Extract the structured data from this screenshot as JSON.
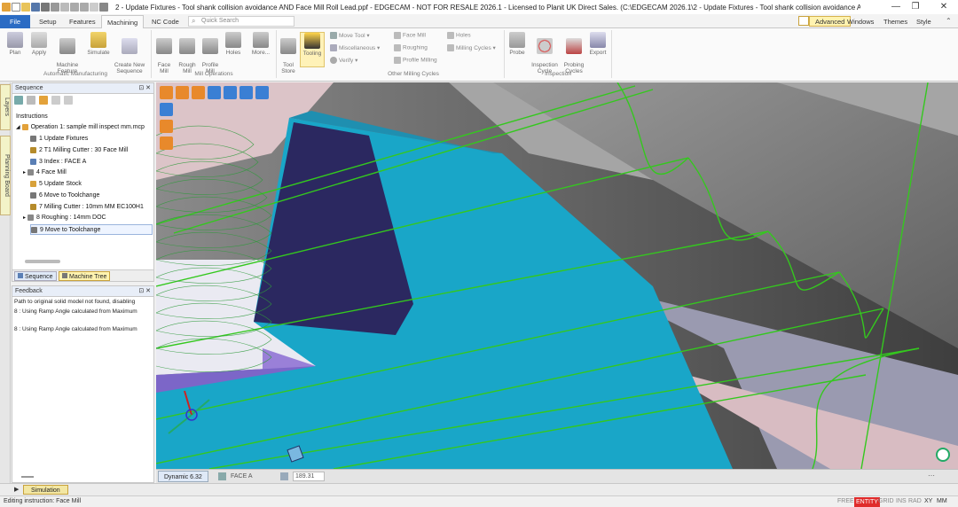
{
  "title_bar": {
    "title": "2  - Update Fixtures - Tool shank collision avoidance AND Face Mill Roll Lead.ppf - EDGECAM - NOT FOR RESALE 2026.1  - Licensed to Planit UK Direct Sales. (C:\\EDGECAM 2026.1\\2  - Update Fixtures - Tool shank collision avoidance AND ...",
    "minimize": "—",
    "maximize": "❐",
    "close": "✕"
  },
  "tabs": {
    "file": "File",
    "setup": "Setup",
    "features": "Features",
    "machining": "Machining",
    "nc_code": "NC Code",
    "search_placeholder": "Quick Search",
    "advanced": "Advanced",
    "windows": "Windows",
    "themes": "Themes",
    "style": "Style"
  },
  "ribbon": {
    "plan": "Plan",
    "apply": "Apply",
    "machine_feature": "Machine\nFeature",
    "simulate": "Simulate",
    "create_new_sequence": "Create New\nSequence",
    "face_mill": "Face\nMill",
    "rough_mill": "Rough\nMill",
    "profile_mill": "Profile\nMill",
    "holes": "Holes",
    "more": "More...",
    "tool_store": "Tool\nStore",
    "tooling": "Tooling",
    "move_tool": "Move Tool",
    "miscellaneous": "Miscellaneous",
    "verify": "Verify",
    "face_mill_small": "Face Mill",
    "roughing": "Roughing",
    "profile_milling": "Profile Milling",
    "holes_small": "Holes",
    "milling_cycles": "Milling Cycles",
    "probe": "Probe",
    "inspection_cycle": "Inspection\nCycle",
    "probing_cycles": "Probing\nCycles",
    "export": "Export",
    "group_automatic": "Automatic Manufacturing",
    "group_mill_ops": "Mill Operations",
    "group_other_milling": "Other Milling Cycles",
    "group_inspection": "Inspection"
  },
  "side_tabs": {
    "layers": "Layers",
    "planning_board": "Planning Board"
  },
  "sequence_panel": {
    "title": "Sequence",
    "pin": "⊡ ✕",
    "instructions_label": "Instructions",
    "operation": "Operation 1: sample mill inspect mm.mcp",
    "items": [
      "1 Update Fixtures",
      "2 T1 Milling Cutter : 30 Face Mill",
      "3 Index : FACE A",
      "4 Face Mill",
      "5 Update Stock",
      "6 Move to Toolchange",
      "7 Milling Cutter : 10mm MM EC100H1",
      "8 Roughing : 14mm DOC",
      "9 Move to Toolchange"
    ],
    "tab_sequence": "Sequence",
    "tab_machine_tree": "Machine Tree"
  },
  "feedback_panel": {
    "title": "Feedback",
    "lines": [
      "Path to original solid model not found, disabling",
      "8 : Using Ramp Angle calculated from Maximum",
      "",
      "8 : Using Ramp Angle calculated from Maximum"
    ]
  },
  "viewport_bar": {
    "dynamic": "Dynamic 6.32",
    "face": "FACE A",
    "value": "189.31"
  },
  "simulation_tab": "Simulation",
  "status": {
    "left": "Editing instruction:  Face Mill",
    "free": "FREE",
    "entity": "ENTITY",
    "grid": "GRID",
    "ins": "INS",
    "rad": "RAD",
    "xy": "XY",
    "mm": "MM"
  },
  "colors": {
    "accent_blue": "#2b6cc4",
    "part_cyan": "#1aa0c4",
    "toolpath_green": "#2ec21f",
    "pocket_navy": "#2b2860"
  }
}
